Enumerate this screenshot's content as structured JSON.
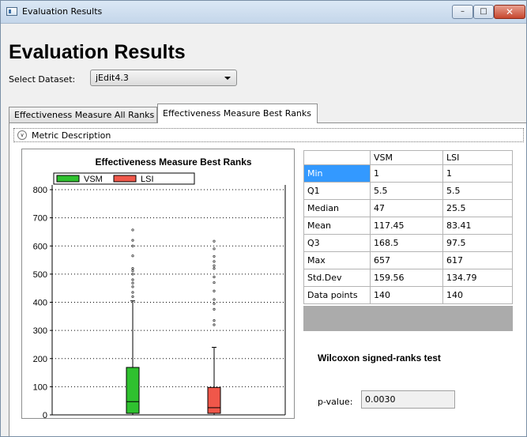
{
  "window": {
    "title": "Evaluation Results"
  },
  "page": {
    "title": "Evaluation Results"
  },
  "dataset": {
    "label": "Select Dataset:",
    "selected": "jEdit4.3"
  },
  "tabs": [
    {
      "label": "Effectiveness Measure All Ranks",
      "active": false
    },
    {
      "label": "Effectiveness Measure Best Ranks",
      "active": true
    }
  ],
  "expander": {
    "label": "Metric Description"
  },
  "stats": {
    "headers": [
      "",
      "VSM",
      "LSI"
    ],
    "rows": [
      [
        "Min",
        "1",
        "1"
      ],
      [
        "Q1",
        "5.5",
        "5.5"
      ],
      [
        "Median",
        "47",
        "25.5"
      ],
      [
        "Mean",
        "117.45",
        "83.41"
      ],
      [
        "Q3",
        "168.5",
        "97.5"
      ],
      [
        "Max",
        "657",
        "617"
      ],
      [
        "Std.Dev",
        "159.56",
        "134.79"
      ],
      [
        "Data points",
        "140",
        "140"
      ]
    ]
  },
  "wilcoxon": {
    "title": "Wilcoxon signed-ranks test",
    "pvalue_label": "p-value:",
    "pvalue": "0.0030"
  },
  "colors": {
    "vsm": "#2fc12f",
    "lsi": "#f0574a",
    "selected_row": "#3399ff"
  },
  "chart_data": {
    "type": "box",
    "title": "Effectiveness Measure Best Ranks",
    "ylim": [
      0,
      800
    ],
    "yticks": [
      0,
      100,
      200,
      300,
      400,
      500,
      600,
      700,
      800
    ],
    "grid": true,
    "legend_position": "top",
    "series": [
      {
        "name": "VSM",
        "color": "#2fc12f",
        "q1": 5.5,
        "median": 47,
        "q3": 168.5,
        "whisker_low": 1,
        "whisker_high": 405,
        "outliers": [
          420,
          435,
          455,
          468,
          480,
          500,
          512,
          520,
          565,
          600,
          620,
          657
        ]
      },
      {
        "name": "LSI",
        "color": "#f0574a",
        "q1": 5.5,
        "median": 25.5,
        "q3": 97.5,
        "whisker_low": 1,
        "whisker_high": 240,
        "outliers": [
          320,
          335,
          375,
          395,
          410,
          440,
          470,
          490,
          520,
          530,
          545,
          563,
          590,
          617
        ]
      }
    ]
  }
}
